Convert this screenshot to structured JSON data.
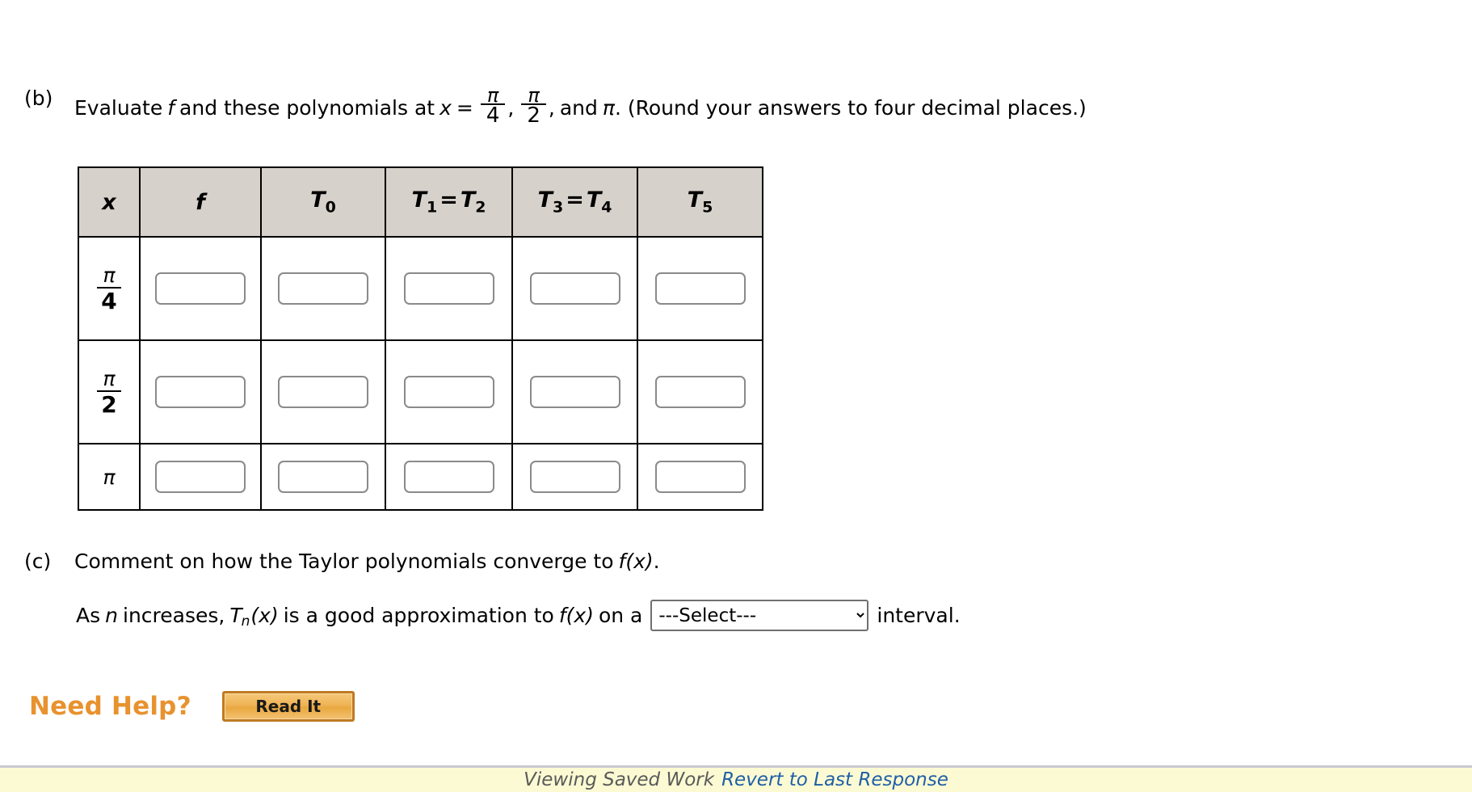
{
  "part_b": {
    "label": "(b)",
    "text_1": "Evaluate",
    "var_f": "f",
    "text_2": "and these polynomials at",
    "var_x": "x",
    "equals": "=",
    "frac1": {
      "num": "π",
      "den": "4"
    },
    "comma1": ",",
    "frac2": {
      "num": "π",
      "den": "2"
    },
    "comma2": ",",
    "text_3": "and",
    "pi": "π",
    "text_4": ". (Round your answers to four decimal places.)"
  },
  "table": {
    "headers": [
      {
        "main": "x",
        "sub": ""
      },
      {
        "main": "f",
        "sub": ""
      },
      {
        "main": "T",
        "sub": "0"
      },
      {
        "main": "T",
        "sub": "1",
        "eq": "=",
        "main2": "T",
        "sub2": "2"
      },
      {
        "main": "T",
        "sub": "3",
        "eq": "=",
        "main2": "T",
        "sub2": "4"
      },
      {
        "main": "T",
        "sub": "5"
      }
    ],
    "header_bg": "#d6d1ca",
    "rows": [
      {
        "x_num": "π",
        "x_den": "4",
        "values": [
          "",
          "",
          "",
          "",
          ""
        ]
      },
      {
        "x_num": "π",
        "x_den": "2",
        "values": [
          "",
          "",
          "",
          "",
          ""
        ]
      },
      {
        "x_num": "π",
        "x_den": "",
        "values": [
          "",
          "",
          "",
          "",
          ""
        ]
      }
    ],
    "input_placeholder": ""
  },
  "part_c": {
    "label": "(c)",
    "text_1": "Comment on how the Taylor polynomials converge to",
    "fx": "f(x)",
    "text_2": ".",
    "line2": {
      "text_1": "As",
      "var_n": "n",
      "text_2": "increases,",
      "T": "T",
      "sub_n": "n",
      "paren_x": "(x)",
      "text_3": "is a good approximation to",
      "fx": "f(x)",
      "text_4": "on a",
      "select_value": "---Select---",
      "select_options": [
        "---Select---"
      ],
      "text_5": "interval."
    }
  },
  "need_help": {
    "label": "Need Help?",
    "label_color": "#e8922e",
    "button_label": "Read It"
  },
  "bottom_bar": {
    "saved_text": "Viewing Saved Work",
    "revert_link": "Revert to Last Response",
    "background": "#fbfad3",
    "link_color": "#1f5fa8"
  }
}
